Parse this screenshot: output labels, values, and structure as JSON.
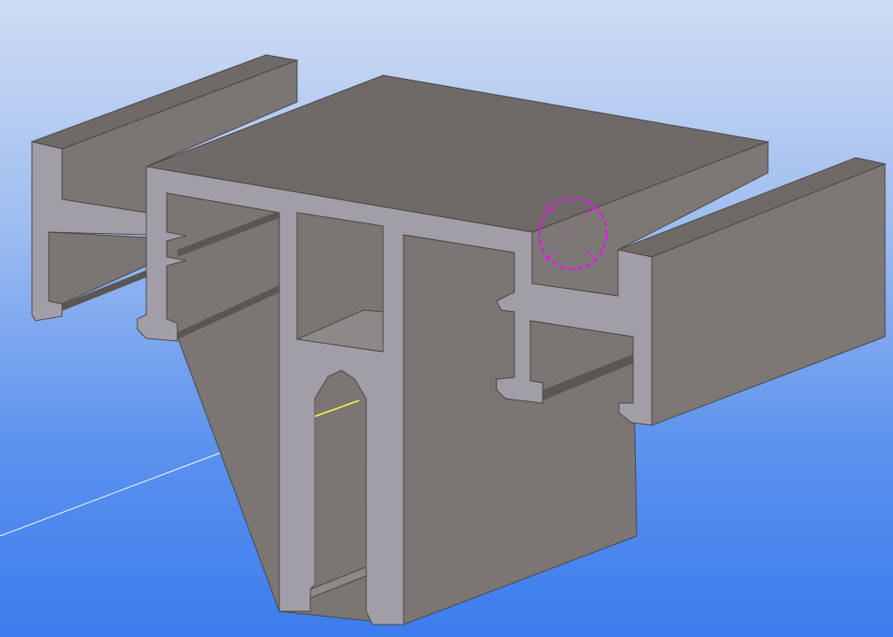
{
  "viewport": {
    "colors": {
      "background_top": "#cfdcf3",
      "background_bottom": "#3c7ced",
      "section_face": "#a19ea7",
      "side_face": "#7c7674",
      "top_face": "#6f6a68",
      "selection_marker": "#ff00ff",
      "axis_line": "#ffffff",
      "highlight_edge": "#ffff40"
    }
  }
}
